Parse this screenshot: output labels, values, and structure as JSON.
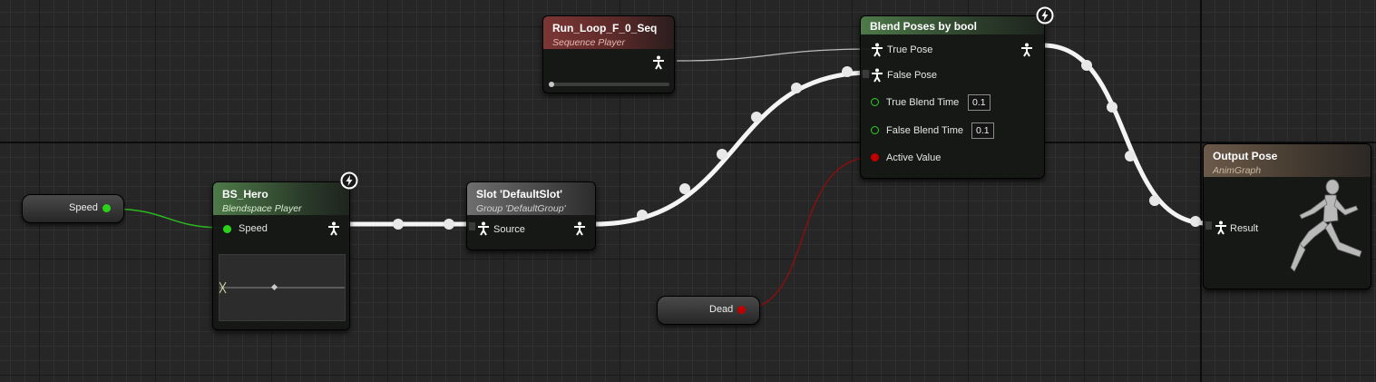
{
  "variables": {
    "speed": {
      "label": "Speed",
      "pin_color": "#2bd21a"
    },
    "dead": {
      "label": "Dead",
      "pin_color": "#c00000"
    }
  },
  "bs_hero": {
    "title": "BS_Hero",
    "subtitle": "Blendspace Player",
    "input_label": "Speed",
    "header_color": "#4e7a49"
  },
  "slot": {
    "title": "Slot 'DefaultSlot'",
    "subtitle": "Group 'DefaultGroup'",
    "source_label": "Source",
    "header_color": "#6e6e6e"
  },
  "run_loop": {
    "title": "Run_Loop_F_0_Seq",
    "subtitle": "Sequence Player",
    "header_color": "#7c3634"
  },
  "blend_poses": {
    "title": "Blend Poses by bool",
    "header_color": "#4e7a49",
    "pins": {
      "true_pose": "True Pose",
      "false_pose": "False Pose",
      "true_blend_time": "True Blend Time",
      "false_blend_time": "False Blend Time",
      "active_value": "Active Value"
    },
    "true_blend_time_value": "0.1",
    "false_blend_time_value": "0.1"
  },
  "output_pose": {
    "title": "Output Pose",
    "subtitle": "AnimGraph",
    "result_label": "Result",
    "header_color": "#6b5a4a"
  },
  "icons": {
    "pose": "pose-pin-icon",
    "fast_path": "lightning-icon",
    "mannequin": "running-mannequin-icon"
  }
}
